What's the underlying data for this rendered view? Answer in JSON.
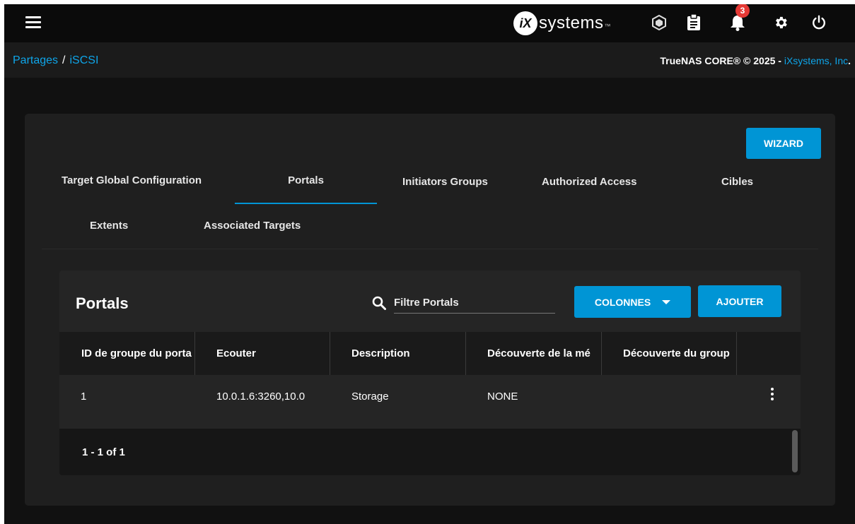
{
  "topbar": {
    "brand_mark": "iX",
    "brand_text": "systems",
    "brand_tm": "™",
    "notification_count": "3",
    "icons": [
      "menu-icon",
      "truecommand-icon",
      "clipboard-icon",
      "bell-icon",
      "gear-icon",
      "power-icon"
    ]
  },
  "breadcrumb": {
    "parent": "Partages",
    "separator": "/",
    "current": "iSCSI"
  },
  "copyright": {
    "text": "TrueNAS CORE® © 2025 - ",
    "link": "iXsystems, Inc",
    "suffix": "."
  },
  "card": {
    "wizard_label": "WIZARD",
    "tabs": [
      "Target Global Configuration",
      "Portals",
      "Initiators Groups",
      "Authorized Access",
      "Cibles",
      "Extents",
      "Associated Targets"
    ],
    "active_tab": "Portals"
  },
  "table": {
    "title": "Portals",
    "search_placeholder": "Filtre Portals",
    "columns_button": "COLONNES",
    "add_button": "AJOUTER",
    "headers": [
      "ID de groupe du porta",
      "Ecouter",
      "Description",
      "Découverte de la mé",
      "Découverte du group"
    ],
    "rows": [
      [
        "1",
        "10.0.1.6:3260,10.0",
        "Storage",
        "NONE",
        ""
      ]
    ],
    "pager": "1 - 1 of 1"
  },
  "colors": {
    "accent": "#0095d5",
    "badge": "#e53935",
    "background": "#111111",
    "card": "#1f1f1f"
  }
}
